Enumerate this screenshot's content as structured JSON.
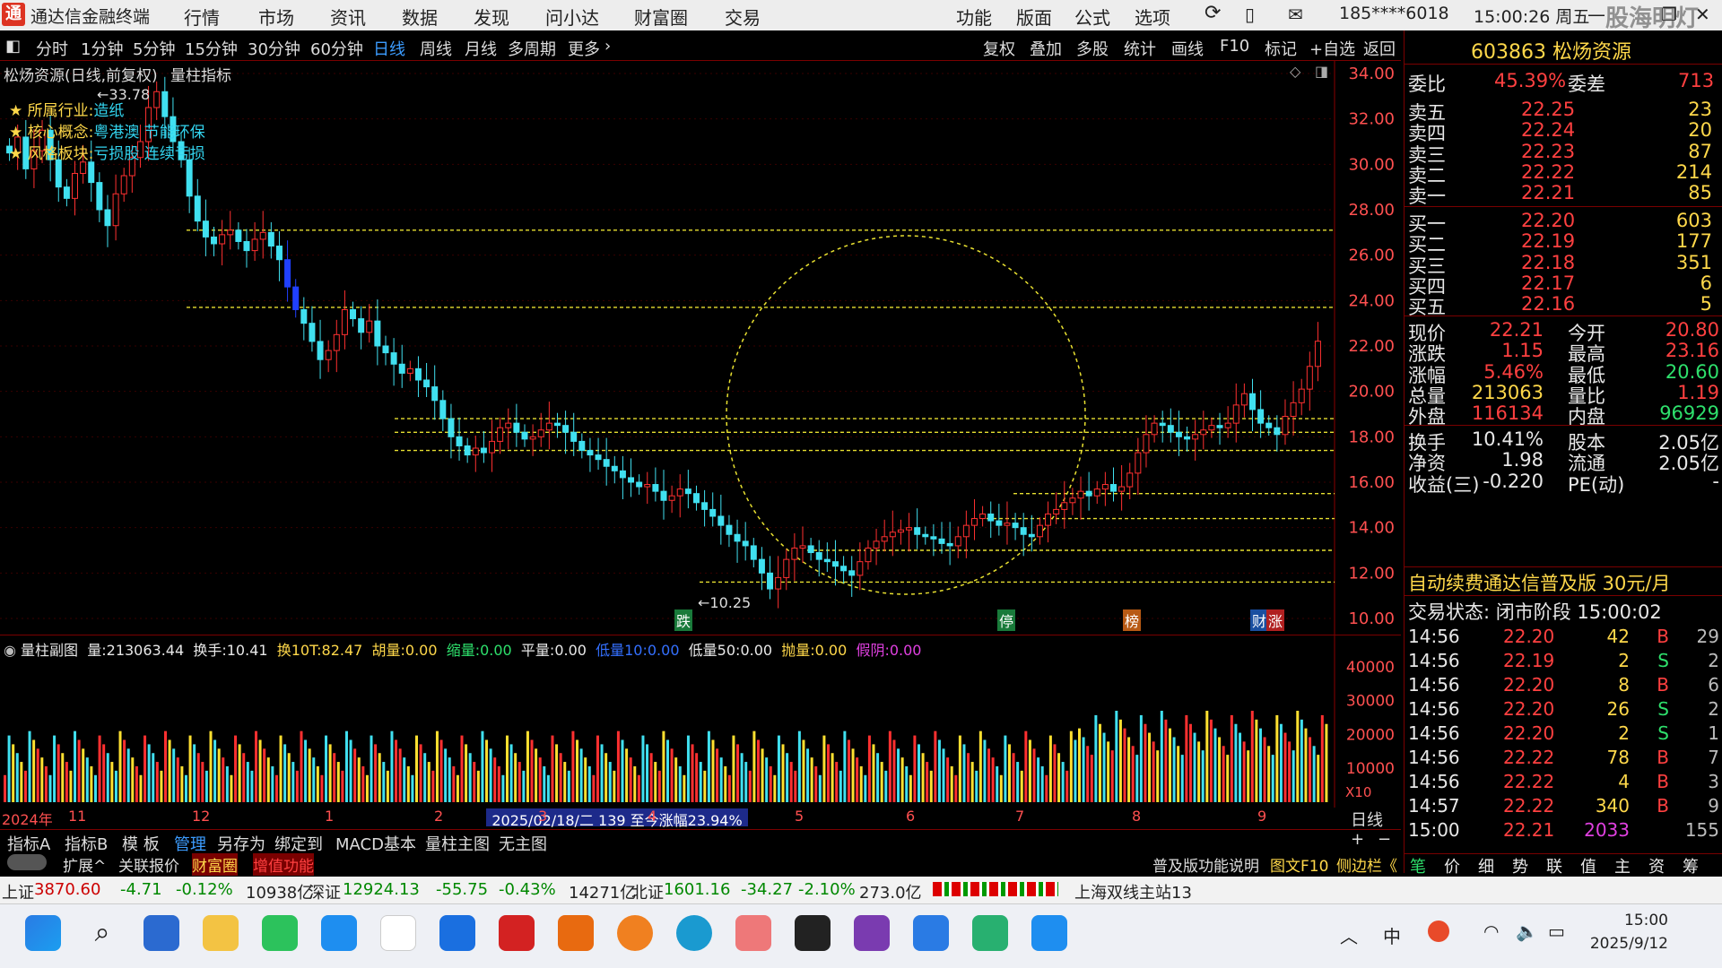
{
  "window": {
    "title": "通达信金融终端",
    "menus": [
      "行情",
      "市场",
      "资讯",
      "数据",
      "发现",
      "问小达",
      "财富圈",
      "交易"
    ],
    "right_menus": [
      "功能",
      "版面",
      "公式",
      "选项"
    ],
    "account": "185****6018",
    "clock": "15:00:26 周五",
    "watermark": "股海明灯"
  },
  "periods": [
    "分时",
    "1分钟",
    "5分钟",
    "15分钟",
    "30分钟",
    "60分钟",
    "日线",
    "周线",
    "月线",
    "多周期",
    "更多"
  ],
  "active_period": "日线",
  "toolbar_right": [
    "复权",
    "叠加",
    "多股",
    "统计",
    "画线",
    "F10",
    "标记",
    "+自选",
    "返回"
  ],
  "chart": {
    "title": "松炀资源(日线,前复权)",
    "indicator": "量柱指标",
    "high_label": "←33.78",
    "low_label": "←10.25",
    "info": [
      {
        "key": "所属行业:",
        "val": "造纸"
      },
      {
        "key": "核心概念:",
        "val": "粤港澳 节能环保"
      },
      {
        "key": "风格板块:",
        "val": "亏损股 连续亏损"
      }
    ],
    "event_labels": [
      "跌",
      "停",
      "榜",
      "财",
      "涨"
    ]
  },
  "chart_data": {
    "type": "candlestick",
    "ylim": [
      10,
      34
    ],
    "yticks": [
      "34.00",
      "32.00",
      "30.00",
      "28.00",
      "26.00",
      "24.00",
      "22.00",
      "20.00",
      "18.00",
      "16.00",
      "14.00",
      "12.00",
      "10.00"
    ],
    "volume_yticks": [
      "40000",
      "30000",
      "20000",
      "10000"
    ],
    "volume_unit": "X10",
    "x_labels": [
      "2024年",
      "11",
      "12",
      "1",
      "2",
      "3",
      "4",
      "5",
      "6",
      "7",
      "8",
      "9"
    ],
    "range_label": "2025/02/18/二 139 至今涨幅23.94%",
    "guide_lines": [
      27.1,
      23.7,
      18.8,
      18.2,
      17.4,
      15.5,
      14.4,
      13.0,
      11.6
    ],
    "close_series": [
      30.5,
      31.2,
      29.8,
      30.6,
      31.5,
      30.2,
      29.0,
      28.5,
      29.6,
      30.1,
      29.2,
      28.0,
      27.3,
      28.7,
      29.5,
      30.3,
      31.0,
      32.5,
      33.2,
      32.1,
      31.0,
      30.2,
      28.6,
      27.5,
      26.8,
      26.5,
      26.9,
      27.1,
      26.6,
      26.2,
      26.7,
      27.0,
      26.4,
      25.8,
      24.6,
      23.6,
      23.0,
      22.2,
      21.4,
      21.8,
      22.5,
      23.6,
      23.2,
      22.6,
      23.1,
      22.0,
      21.7,
      21.2,
      20.8,
      21.0,
      20.5,
      20.2,
      19.6,
      18.8,
      18.0,
      17.6,
      17.2,
      17.5,
      17.3,
      17.8,
      18.4,
      18.6,
      18.2,
      17.9,
      18.0,
      18.3,
      18.6,
      18.5,
      18.2,
      17.8,
      17.4,
      17.2,
      17.0,
      16.7,
      16.5,
      16.2,
      16.0,
      15.8,
      15.9,
      15.6,
      15.2,
      15.4,
      15.7,
      15.5,
      15.1,
      14.8,
      14.5,
      14.1,
      13.7,
      13.4,
      13.2,
      12.6,
      12.0,
      11.3,
      11.8,
      12.6,
      13.1,
      13.2,
      12.9,
      12.6,
      12.5,
      12.3,
      12.1,
      11.9,
      12.5,
      13.1,
      13.4,
      13.6,
      13.8,
      13.9,
      14.0,
      13.7,
      13.6,
      13.5,
      13.3,
      13.2,
      13.6,
      14.1,
      14.4,
      14.6,
      14.3,
      14.1,
      14.2,
      14.0,
      13.7,
      13.6,
      14.1,
      14.6,
      14.8,
      15.1,
      15.3,
      15.6,
      15.4,
      15.7,
      15.9,
      15.6,
      15.8,
      16.4,
      17.3,
      18.1,
      18.6,
      18.5,
      18.2,
      18.0,
      17.9,
      18.1,
      18.3,
      18.5,
      18.4,
      18.6,
      19.4,
      19.9,
      19.2,
      18.6,
      18.4,
      18.1,
      18.9,
      19.5,
      20.1,
      21.1,
      22.21
    ]
  },
  "vol_header": {
    "name": "量柱副图",
    "items": [
      {
        "k": "量:",
        "v": "213063.44"
      },
      {
        "k": "换手:",
        "v": "10.41"
      },
      {
        "k": "换10T:",
        "v": "82.47"
      },
      {
        "k": "胡量:",
        "v": "0.00"
      },
      {
        "k": "缩量:",
        "v": "0.00"
      },
      {
        "k": "平量:",
        "v": "0.00"
      },
      {
        "k": "低量10:",
        "v": "0.00"
      },
      {
        "k": "低量50:",
        "v": "0.00"
      },
      {
        "k": "抛量:",
        "v": "0.00"
      },
      {
        "k": "假阴:",
        "v": "0.00"
      }
    ]
  },
  "tabs": [
    "指标A",
    "指标B",
    "模 板",
    "管理",
    "另存为",
    "绑定到",
    "MACD基本",
    "量柱主图",
    "无主图"
  ],
  "tabs2": [
    "扩展^",
    "关联报价",
    "财富圈",
    "增值功能"
  ],
  "bottom_right": [
    "普及版功能说明",
    "图文F10",
    "侧边栏《"
  ],
  "bottom_period": "日线",
  "quote": {
    "code_name": "603863 松炀资源",
    "weibi": "45.39%",
    "weicha": "713",
    "asks": [
      {
        "l": "卖五",
        "p": "22.25",
        "v": "23"
      },
      {
        "l": "卖四",
        "p": "22.24",
        "v": "20"
      },
      {
        "l": "卖三",
        "p": "22.23",
        "v": "87"
      },
      {
        "l": "卖二",
        "p": "22.22",
        "v": "214"
      },
      {
        "l": "卖一",
        "p": "22.21",
        "v": "85"
      }
    ],
    "bids": [
      {
        "l": "买一",
        "p": "22.20",
        "v": "603"
      },
      {
        "l": "买二",
        "p": "22.19",
        "v": "177"
      },
      {
        "l": "买三",
        "p": "22.18",
        "v": "351"
      },
      {
        "l": "买四",
        "p": "22.17",
        "v": "6"
      },
      {
        "l": "买五",
        "p": "22.16",
        "v": "5"
      }
    ],
    "stats": [
      {
        "a": "现价",
        "av": "22.21",
        "b": "今开",
        "bv": "20.80"
      },
      {
        "a": "涨跌",
        "av": "1.15",
        "b": "最高",
        "bv": "23.16"
      },
      {
        "a": "涨幅",
        "av": "5.46%",
        "b": "最低",
        "bv": "20.60"
      },
      {
        "a": "总量",
        "av": "213063",
        "b": "量比",
        "bv": "1.19"
      },
      {
        "a": "外盘",
        "av": "116134",
        "b": "内盘",
        "bv": "96929"
      }
    ],
    "stats2": [
      {
        "a": "换手",
        "av": "10.41%",
        "b": "股本",
        "bv": "2.05亿"
      },
      {
        "a": "净资",
        "av": "1.98",
        "b": "流通",
        "bv": "2.05亿"
      },
      {
        "a": "收益(三)",
        "av": "-0.220",
        "b": "PE(动)",
        "bv": "-"
      }
    ],
    "promo": "自动续费通达信普及版 30元/月",
    "trade_state": "交易状态: 闭市阶段 15:00:02",
    "ticks": [
      {
        "t": "14:56",
        "p": "22.20",
        "v": "42",
        "s": "B",
        "n": "29"
      },
      {
        "t": "14:56",
        "p": "22.19",
        "v": "2",
        "s": "S",
        "n": "2"
      },
      {
        "t": "14:56",
        "p": "22.20",
        "v": "8",
        "s": "B",
        "n": "6"
      },
      {
        "t": "14:56",
        "p": "22.20",
        "v": "26",
        "s": "S",
        "n": "2"
      },
      {
        "t": "14:56",
        "p": "22.20",
        "v": "2",
        "s": "S",
        "n": "1"
      },
      {
        "t": "14:56",
        "p": "22.22",
        "v": "78",
        "s": "B",
        "n": "7"
      },
      {
        "t": "14:56",
        "p": "22.22",
        "v": "4",
        "s": "B",
        "n": "3"
      },
      {
        "t": "14:57",
        "p": "22.22",
        "v": "340",
        "s": "B",
        "n": "9"
      },
      {
        "t": "15:00",
        "p": "22.21",
        "v": "2033",
        "s": "",
        "n": "155"
      }
    ],
    "bottom_tabs": [
      "笔",
      "价",
      "细",
      "势",
      "联",
      "值",
      "主",
      "资",
      "筹"
    ]
  },
  "status": {
    "sh": "上证",
    "sh_v": "3870.60",
    "sh_c": "-4.71",
    "sh_p": "-0.12%",
    "sh_a": "10938亿",
    "sz": "深证",
    "sz_v": "12924.13",
    "sz_c": "-55.75",
    "sz_p": "-0.43%",
    "sz_a": "14271亿",
    "bz": "北证",
    "bz_v": "1601.16",
    "bz_c": "-34.27",
    "bz_p": "-2.10%",
    "bz_a": "273.0亿",
    "station": "上海双线主站13"
  },
  "taskbar": {
    "time": "15:00",
    "date": "2025/9/12",
    "ime": "中"
  }
}
